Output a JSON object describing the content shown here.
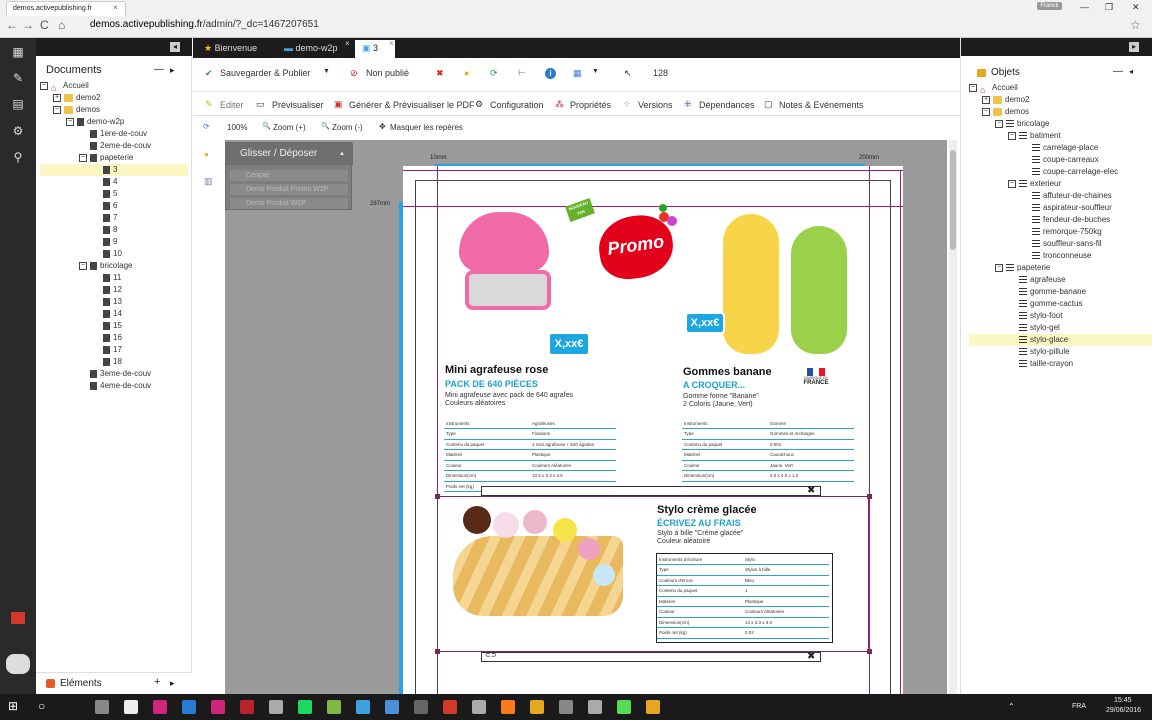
{
  "browser": {
    "tab_title": "demos.activepublishing.fr",
    "close": "×",
    "user": "Franck",
    "min": "—",
    "max": "❐",
    "win_close": "✕",
    "url_host": "demos.activepublishing.fr",
    "url_path": "/admin/?_dc=1467207651",
    "back": "←",
    "forward": "→",
    "reload": "C",
    "home": "⌂",
    "star": "☆"
  },
  "left_panel": {
    "title": "Documents",
    "minus": "—",
    "arrow": "▸",
    "collapse": "◂",
    "tree": [
      {
        "label": "Accueil",
        "indent": 0,
        "toggle": "−",
        "icon": "home"
      },
      {
        "label": "demo2",
        "indent": 1,
        "toggle": "+",
        "icon": "folder"
      },
      {
        "label": "demos",
        "indent": 1,
        "toggle": "−",
        "icon": "folder"
      },
      {
        "label": "demo-w2p",
        "indent": 2,
        "toggle": "−",
        "icon": "doc"
      },
      {
        "label": "1ere-de-couv",
        "indent": 3,
        "toggle": "",
        "icon": "doc"
      },
      {
        "label": "2eme-de-couv",
        "indent": 3,
        "toggle": "",
        "icon": "doc"
      },
      {
        "label": "papeterie",
        "indent": 3,
        "toggle": "−",
        "icon": "doc"
      },
      {
        "label": "3",
        "indent": 4,
        "toggle": "",
        "icon": "doc",
        "selected": true
      },
      {
        "label": "4",
        "indent": 4,
        "toggle": "",
        "icon": "doc"
      },
      {
        "label": "5",
        "indent": 4,
        "toggle": "",
        "icon": "doc"
      },
      {
        "label": "6",
        "indent": 4,
        "toggle": "",
        "icon": "doc"
      },
      {
        "label": "7",
        "indent": 4,
        "toggle": "",
        "icon": "doc"
      },
      {
        "label": "8",
        "indent": 4,
        "toggle": "",
        "icon": "doc"
      },
      {
        "label": "9",
        "indent": 4,
        "toggle": "",
        "icon": "doc"
      },
      {
        "label": "10",
        "indent": 4,
        "toggle": "",
        "icon": "doc"
      },
      {
        "label": "bricolage",
        "indent": 3,
        "toggle": "−",
        "icon": "doc"
      },
      {
        "label": "11",
        "indent": 4,
        "toggle": "",
        "icon": "doc"
      },
      {
        "label": "12",
        "indent": 4,
        "toggle": "",
        "icon": "doc"
      },
      {
        "label": "13",
        "indent": 4,
        "toggle": "",
        "icon": "doc"
      },
      {
        "label": "14",
        "indent": 4,
        "toggle": "",
        "icon": "doc"
      },
      {
        "label": "15",
        "indent": 4,
        "toggle": "",
        "icon": "doc"
      },
      {
        "label": "16",
        "indent": 4,
        "toggle": "",
        "icon": "doc"
      },
      {
        "label": "17",
        "indent": 4,
        "toggle": "",
        "icon": "doc"
      },
      {
        "label": "18",
        "indent": 4,
        "toggle": "",
        "icon": "doc"
      },
      {
        "label": "3eme-de-couv",
        "indent": 3,
        "toggle": "",
        "icon": "doc"
      },
      {
        "label": "4eme-de-couv",
        "indent": 3,
        "toggle": "",
        "icon": "doc"
      }
    ],
    "bottom_label": "Eléments",
    "plus": "+"
  },
  "tabs": [
    {
      "label": "Bienvenue",
      "icon": "★",
      "close": ""
    },
    {
      "label": "demo-w2p",
      "icon": "▬",
      "close": "×"
    },
    {
      "label": "3",
      "icon": "▣",
      "close": "×",
      "active": true
    }
  ],
  "toolbar1": {
    "save_publish": "Sauvegarder & Publier",
    "dropdown": "▼",
    "unpublished": "Non publié",
    "count": "128",
    "icons": {
      "check": "✔",
      "block": "⊘",
      "delete": "✖",
      "bulb": "●",
      "refresh": "⟳",
      "tree": "⊢",
      "info": "i",
      "layout": "▦",
      "pointer": "↖"
    }
  },
  "toolbar2": {
    "edit": "Editer",
    "preview": "Prévisualiser",
    "pdf": "Générer & Prévisualiser le PDF",
    "config": "Configuration",
    "props": "Propriétés",
    "versions": "Versions",
    "deps": "Dépendances",
    "notes": "Notes & Evénements",
    "icons": {
      "pencil": "✎",
      "eye": "▭",
      "pdf": "▣",
      "gear": "⚙",
      "props": "⁂",
      "versions": "⁘",
      "deps": "⁜",
      "notes": "▢"
    }
  },
  "toolbar3": {
    "zoom_100": "100%",
    "zoom_in": "Zoom (+)",
    "zoom_out": "Zoom (-)",
    "hide_marks": "Masquer les repères",
    "icons": {
      "sync": "⟳",
      "zoom": "🔍",
      "move": "✥"
    }
  },
  "side_tools": {
    "bulb": "●",
    "trash": "▥"
  },
  "dragdrop": {
    "title": "Glisser / Déposer",
    "toggle": "▲",
    "items": [
      "Cenpac",
      "Demo Produit Promo W2P",
      "Demo Produit W2P"
    ]
  },
  "rulers": {
    "left_mm": "10mm",
    "right_mm": "200mm",
    "height_mm": "287mm"
  },
  "products": [
    {
      "title": "Mini agrafeuse rose",
      "subtitle": "PACK DE 640 PIÈCES",
      "desc": [
        "Mini agrafeuse avec pack de 640 agrafes",
        "Couleurs aléatoires"
      ],
      "badge": "X,xx€",
      "specs": [
        [
          "Instruments",
          "Agrafeuses"
        ],
        [
          "Type",
          "Fixations"
        ],
        [
          "Contenu du paquet",
          "1 mini agrafeuse + 640 agrafes"
        ],
        [
          "Matériel",
          "Plastique"
        ],
        [
          "Couleur",
          "Couleurs Aléatoires"
        ],
        [
          "Dimension(cm)",
          "10.5 x 9.3 x 3.5"
        ],
        [
          "Poids net (kg)",
          ""
        ]
      ]
    },
    {
      "title": "Gommes banane",
      "subtitle": "A CROQUER...",
      "desc": [
        "Gomme forme \"Banane\"",
        "2 Coloris (Jaune, Vert)"
      ],
      "badge": "X,xx€",
      "flag_text": [
        "FABRIQUÉ EN",
        "FRANCE"
      ],
      "specs": [
        [
          "Instruments",
          "Gomme"
        ],
        [
          "Type",
          "Gommes et recharges"
        ],
        [
          "Contenu du paquet",
          "0.001"
        ],
        [
          "Matériel",
          "Caoutchouc"
        ],
        [
          "Couleur",
          "Jaune, Vert"
        ],
        [
          "Dimension(cm)",
          "4.0 x 4.0 x 1.0"
        ]
      ]
    },
    {
      "title": "Stylo crème glacée",
      "subtitle": "ÉCRIVEZ AU FRAIS",
      "desc": [
        "Stylo à bille \"Crème glacée\"",
        "Couleur aléatoire"
      ],
      "specs": [
        [
          "Instruments d'écriture",
          "Stylo"
        ],
        [
          "Type",
          "Stylos à bille"
        ],
        [
          "Couleurs d'encre",
          "Bleu"
        ],
        [
          "Contenu du paquet",
          "1"
        ],
        [
          "Matériel",
          "Plastique"
        ],
        [
          "Couleur",
          "Couleurs Aléatoires"
        ],
        [
          "Dimension(cm)",
          "14 x 3.3 x 3.0"
        ],
        [
          "Poids net (kg)",
          "0.02"
        ]
      ]
    }
  ],
  "page_deco": {
    "promo": "Promo",
    "tag": "NOUVEAU TAN",
    "mark_x": "✖",
    "mark_o": "⊂⊃"
  },
  "right_panel": {
    "title": "Objets",
    "minus": "—",
    "arrow": "◂",
    "collapse": "▸",
    "tree": [
      {
        "label": "Accueil",
        "indent": 0,
        "toggle": "−",
        "icon": "home"
      },
      {
        "label": "demo2",
        "indent": 1,
        "toggle": "+",
        "icon": "folder"
      },
      {
        "label": "demos",
        "indent": 1,
        "toggle": "−",
        "icon": "folder"
      },
      {
        "label": "bricolage",
        "indent": 2,
        "toggle": "−",
        "icon": "list"
      },
      {
        "label": "batiment",
        "indent": 3,
        "toggle": "−",
        "icon": "list"
      },
      {
        "label": "carrelage-place",
        "indent": 4,
        "toggle": "",
        "icon": "list"
      },
      {
        "label": "coupe-carreaux",
        "indent": 4,
        "toggle": "",
        "icon": "list"
      },
      {
        "label": "coupe-carrelage-elec",
        "indent": 4,
        "toggle": "",
        "icon": "list"
      },
      {
        "label": "exterieur",
        "indent": 3,
        "toggle": "−",
        "icon": "list"
      },
      {
        "label": "affuteur-de-chaines",
        "indent": 4,
        "toggle": "",
        "icon": "list"
      },
      {
        "label": "aspirateur-souffleur",
        "indent": 4,
        "toggle": "",
        "icon": "list"
      },
      {
        "label": "fendeur-de-buches",
        "indent": 4,
        "toggle": "",
        "icon": "list"
      },
      {
        "label": "remorque-750kg",
        "indent": 4,
        "toggle": "",
        "icon": "list"
      },
      {
        "label": "souffleur-sans-fil",
        "indent": 4,
        "toggle": "",
        "icon": "list"
      },
      {
        "label": "tronconneuse",
        "indent": 4,
        "toggle": "",
        "icon": "list"
      },
      {
        "label": "papeterie",
        "indent": 2,
        "toggle": "−",
        "icon": "list"
      },
      {
        "label": "agrafeuse",
        "indent": 3,
        "toggle": "",
        "icon": "list"
      },
      {
        "label": "gomme-banane",
        "indent": 3,
        "toggle": "",
        "icon": "list"
      },
      {
        "label": "gomme-cactus",
        "indent": 3,
        "toggle": "",
        "icon": "list"
      },
      {
        "label": "stylo-foot",
        "indent": 3,
        "toggle": "",
        "icon": "list"
      },
      {
        "label": "stylo-gel",
        "indent": 3,
        "toggle": "",
        "icon": "list"
      },
      {
        "label": "stylo-glace",
        "indent": 3,
        "toggle": "",
        "icon": "list",
        "selected": true
      },
      {
        "label": "stylo-pillule",
        "indent": 3,
        "toggle": "",
        "icon": "list"
      },
      {
        "label": "taille-crayon",
        "indent": 3,
        "toggle": "",
        "icon": "list"
      }
    ]
  },
  "rail_icons": [
    "▦",
    "✎",
    "▤",
    "⚙",
    "⚲"
  ],
  "taskbar": {
    "start": "⊞",
    "search": "○",
    "lang": "FRA",
    "time": "15:45",
    "date": "29/06/2016",
    "up": "⌃",
    "apps": [
      "#888",
      "#eee",
      "#d0267a",
      "#2a7bd3",
      "#d0267a",
      "#b9232d",
      "#aaa",
      "#1ed760",
      "#7fb842",
      "#3ea0e0",
      "#4a90d9",
      "#666",
      "#d13a2a",
      "#aaa",
      "#ff7a1a",
      "#e4a71f",
      "#888",
      "#aaa",
      "#5d5",
      "#e4a71f"
    ]
  },
  "colors": {
    "accent": "#1aa3c9",
    "selected": "#fbf7c4",
    "dark": "#1c1c1c"
  }
}
